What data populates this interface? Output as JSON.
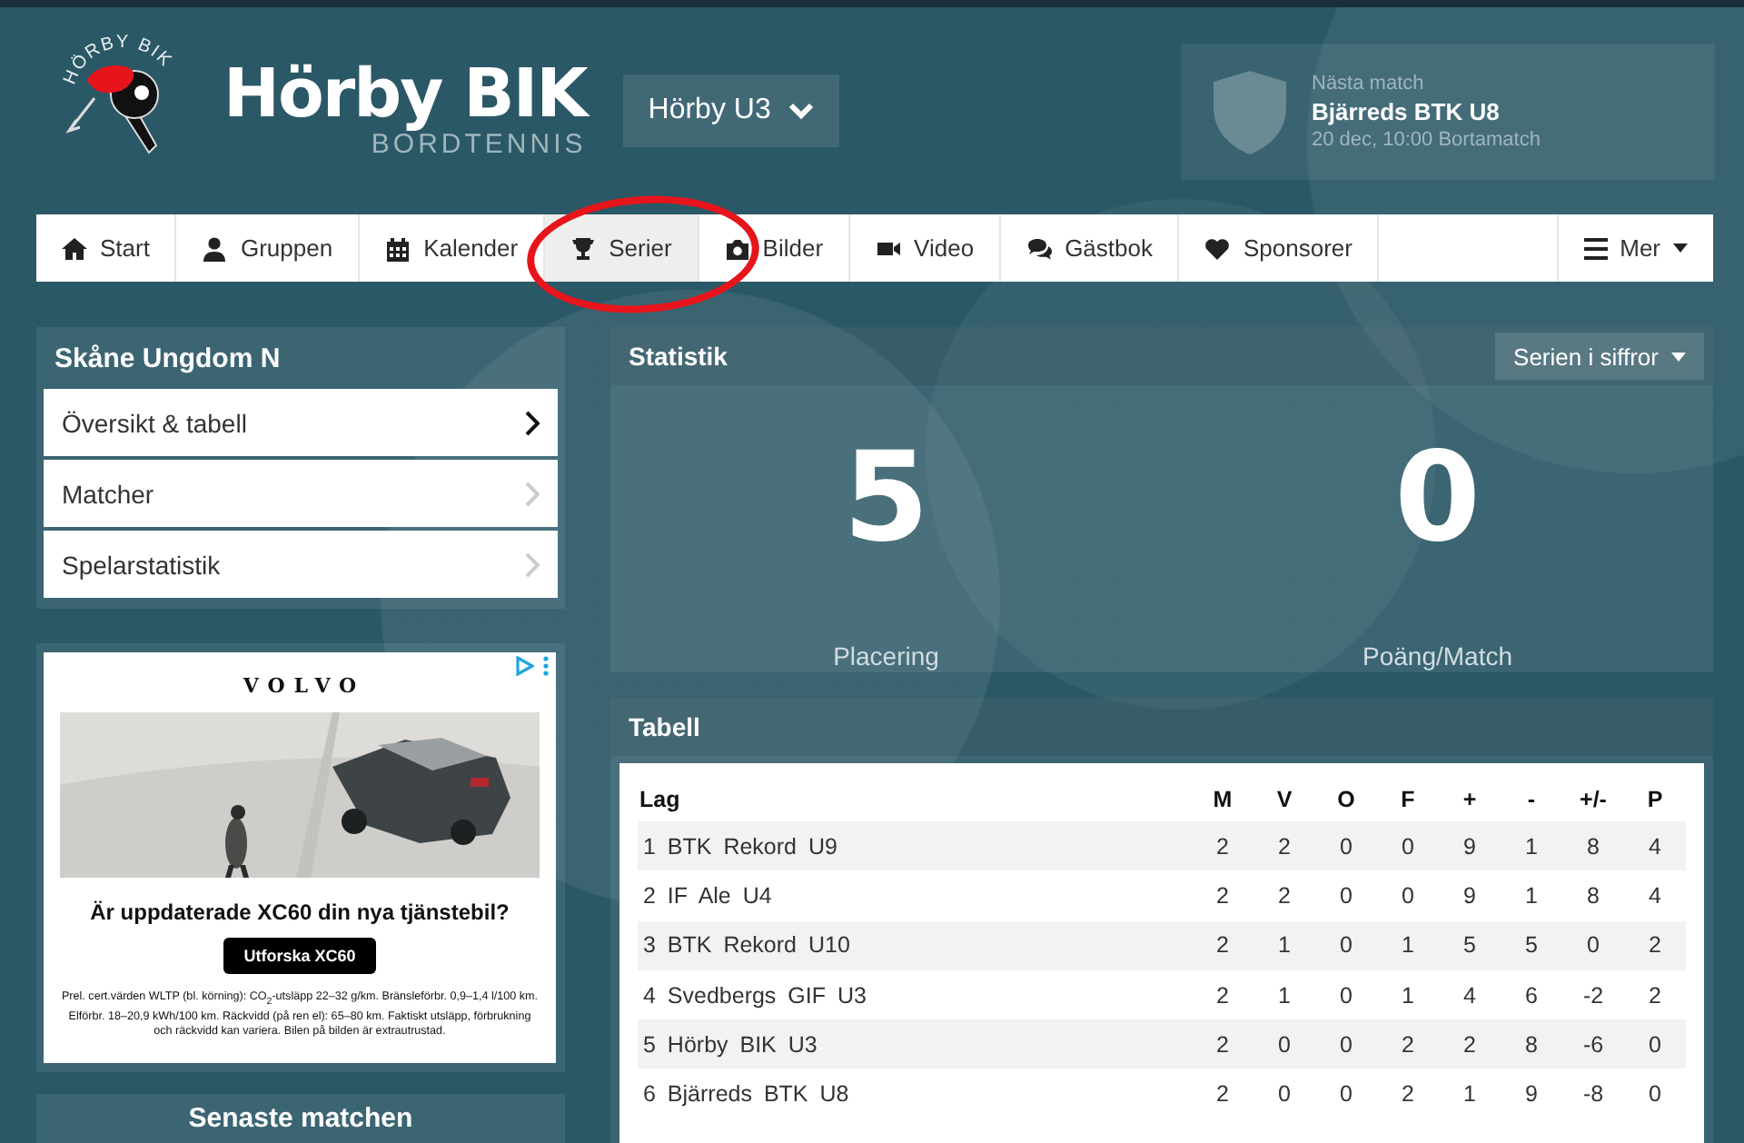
{
  "header": {
    "logo_text": "HÖRBY BIK",
    "title": "Hörby BIK",
    "subtitle": "BORDTENNIS",
    "team_select": "Hörby U3",
    "next_match": {
      "label": "Nästa match",
      "opponent": "Bjärreds BTK U8",
      "when": "20 dec, 10:00 Bortamatch"
    }
  },
  "nav": {
    "items": [
      {
        "label": "Start",
        "selected": false
      },
      {
        "label": "Gruppen",
        "selected": false
      },
      {
        "label": "Kalender",
        "selected": false
      },
      {
        "label": "Serier",
        "selected": true
      },
      {
        "label": "Bilder",
        "selected": false
      },
      {
        "label": "Video",
        "selected": false
      },
      {
        "label": "Gästbok",
        "selected": false
      },
      {
        "label": "Sponsorer",
        "selected": false
      }
    ],
    "more": "Mer"
  },
  "sidebar": {
    "title": "Skåne Ungdom N",
    "items": [
      {
        "label": "Översikt & tabell",
        "selected": true
      },
      {
        "label": "Matcher",
        "selected": false
      },
      {
        "label": "Spelarstatistik",
        "selected": false
      }
    ]
  },
  "ad": {
    "brand": "VOLVO",
    "headline": "Är uppdaterade XC60 din nya tjänstebil?",
    "button": "Utforska XC60",
    "fine_print": "Prel. cert.värden WLTP (bl. körning): CO$_{2}$-utsläpp 22–32 g/km. Bränsleförbr. 0,9–1,4 l/100 km. Elförbr. 18–20,9 kWh/100 km. Räckvidd (på ren el): 65–80 km. Faktiskt utsläpp, förbrukning och räckvidd kan variera. Bilen på bilden är extrautrustad."
  },
  "latest_match": {
    "title": "Senaste matchen"
  },
  "stats": {
    "title": "Statistik",
    "dropdown": "Serien i siffror",
    "values": [
      {
        "value": "5",
        "label": "Placering"
      },
      {
        "value": "0",
        "label": "Poäng/Match"
      }
    ]
  },
  "table": {
    "title": "Tabell",
    "columns": [
      "Lag",
      "M",
      "V",
      "O",
      "F",
      "+",
      "-",
      "+/-",
      "P"
    ],
    "rows": [
      {
        "cells": [
          "1 BTK Rekord U9",
          "2",
          "2",
          "0",
          "0",
          "9",
          "1",
          "8",
          "4"
        ]
      },
      {
        "cells": [
          "2 IF Ale U4",
          "2",
          "2",
          "0",
          "0",
          "9",
          "1",
          "8",
          "4"
        ]
      },
      {
        "cells": [
          "3 BTK Rekord U10",
          "2",
          "1",
          "0",
          "1",
          "5",
          "5",
          "0",
          "2"
        ]
      },
      {
        "cells": [
          "4 Svedbergs GIF U3",
          "2",
          "1",
          "0",
          "1",
          "4",
          "6",
          "-2",
          "2"
        ]
      },
      {
        "cells": [
          "5 Hörby BIK U3",
          "2",
          "0",
          "0",
          "2",
          "2",
          "8",
          "-6",
          "0"
        ]
      },
      {
        "cells": [
          "6 Bjärreds BTK U8",
          "2",
          "0",
          "0",
          "2",
          "1",
          "9",
          "-8",
          "0"
        ]
      }
    ]
  }
}
